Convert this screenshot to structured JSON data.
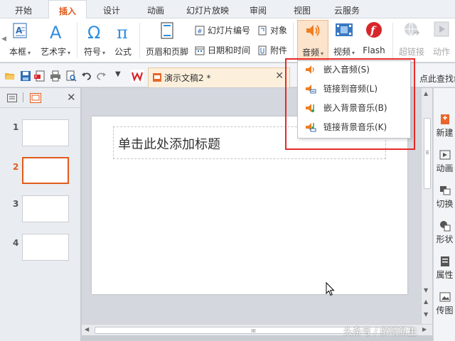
{
  "menu": {
    "tabs": [
      {
        "label": "开始"
      },
      {
        "label": "插入"
      },
      {
        "label": "设计"
      },
      {
        "label": "动画"
      },
      {
        "label": "幻灯片放映"
      },
      {
        "label": "审阅"
      },
      {
        "label": "视图"
      },
      {
        "label": "云服务"
      }
    ],
    "active_tab": "插入"
  },
  "ribbon": {
    "textbox": "本框",
    "wordart": "艺术字",
    "symbol": "符号",
    "formula": "公式",
    "header_footer": "页眉和页脚",
    "slide_number": "幻灯片编号",
    "object": "对象",
    "date_time": "日期和时间",
    "attachment": "附件",
    "audio": "音频",
    "video": "视频",
    "flash": "Flash",
    "hyperlink": "超链接",
    "action": "动作"
  },
  "quickbar": {
    "document_tab": "演示文稿2 *",
    "search_hint": "点此查找命令"
  },
  "audio_menu": {
    "items": [
      {
        "label": "嵌入音频(S)"
      },
      {
        "label": "链接到音频(L)"
      },
      {
        "label": "嵌入背景音乐(B)"
      },
      {
        "label": "链接背景音乐(K)"
      }
    ]
  },
  "thumbnails": {
    "numbers": [
      "1",
      "2",
      "3",
      "4"
    ],
    "active": "2"
  },
  "slide": {
    "title_placeholder": "单击此处添加标题"
  },
  "task_pane": {
    "items": [
      {
        "label": "新建"
      },
      {
        "label": "动画"
      },
      {
        "label": "切换"
      },
      {
        "label": "形状"
      },
      {
        "label": "属性"
      },
      {
        "label": "传图"
      }
    ]
  },
  "watermark": "头条号 / 解晴新生",
  "colors": {
    "accent": "#e05a1c",
    "highlight_box": "#e62a2a"
  }
}
